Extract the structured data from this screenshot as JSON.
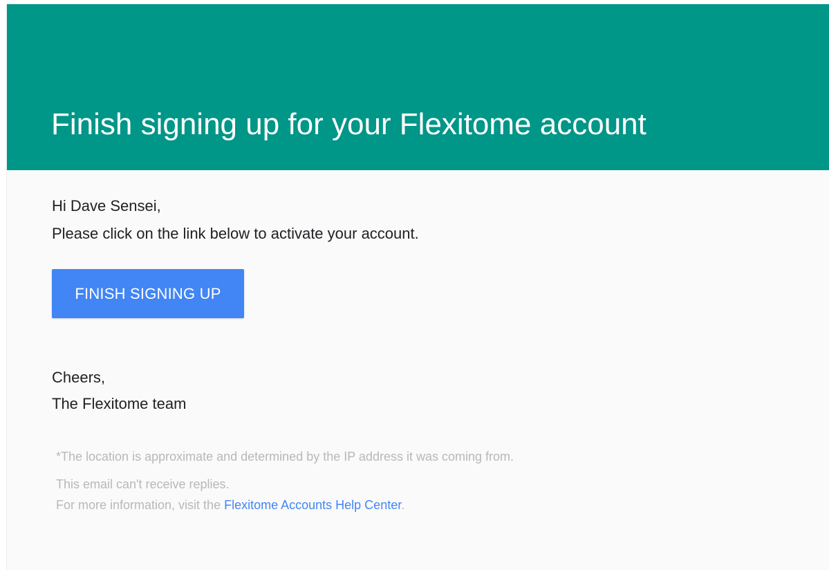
{
  "header": {
    "title": "Finish signing up for your Flexitome account"
  },
  "body": {
    "greeting": "Hi Dave Sensei,",
    "instruction": "Please click on the link below to activate your account.",
    "cta_label": "FINISH SIGNING UP",
    "signoff": "Cheers,",
    "team": "The Flexitome team"
  },
  "footer": {
    "footnote": "*The location is approximate and determined by the IP address it was coming from.",
    "noreply": "This email can't receive replies.",
    "moreinfo_prefix": "For more information, visit the ",
    "help_link": "Flexitome Accounts Help Center",
    "moreinfo_suffix": "."
  },
  "colors": {
    "header_bg": "#009688",
    "button_bg": "#4285f4",
    "link": "#4285f4",
    "footer_text": "#b8b8b8",
    "card_bg": "#fafafa"
  }
}
